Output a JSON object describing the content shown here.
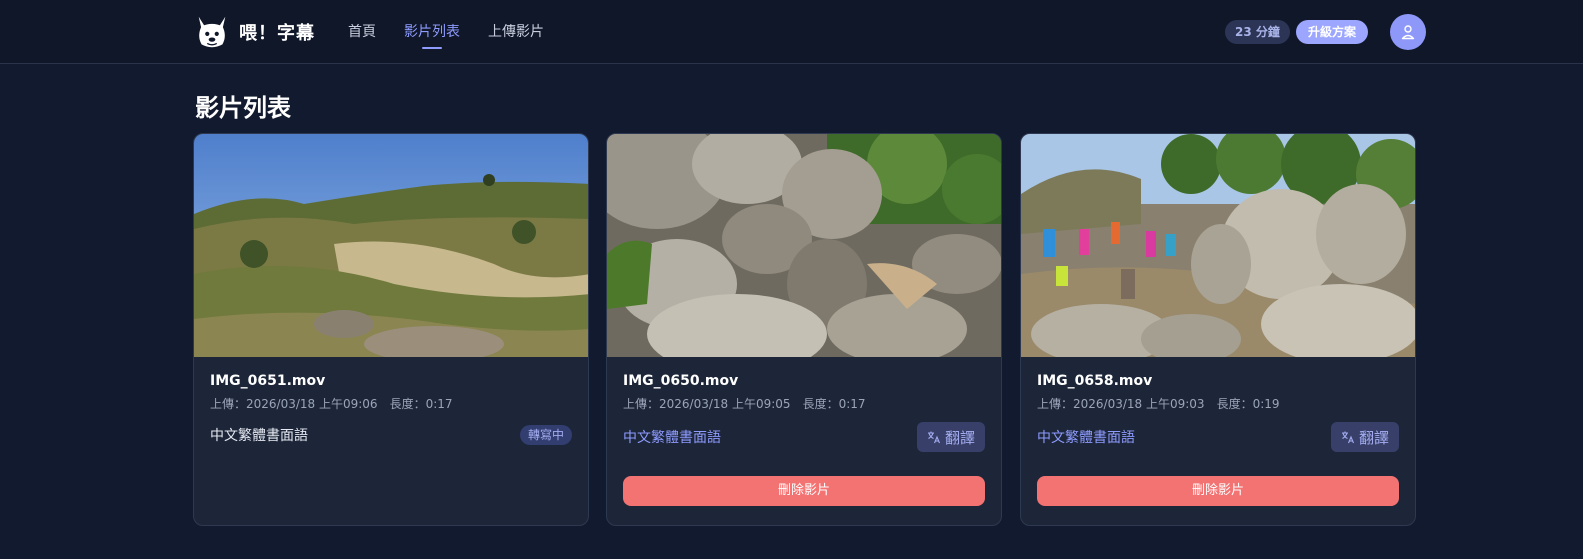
{
  "brand": {
    "name": "喂！字幕",
    "logo_icon": "french-bulldog-logo-icon"
  },
  "nav": [
    {
      "label": "首頁",
      "active": false
    },
    {
      "label": "影片列表",
      "active": true
    },
    {
      "label": "上傳影片",
      "active": false
    }
  ],
  "account": {
    "minutes_left": "23 分鐘",
    "upgrade_label": "升級方案",
    "avatar_icon": "user-icon"
  },
  "page": {
    "title": "影片列表"
  },
  "videos": [
    {
      "file_name": "IMG_0651.mov",
      "uploaded": "上傳：2026/03/18 上午09:06",
      "duration": "長度：0:17",
      "language": "中文繁體書面語",
      "status": "轉寫中",
      "thumbnail": "hillside-grass-thumbnail"
    },
    {
      "file_name": "IMG_0650.mov",
      "uploaded": "上傳：2026/03/18 上午09:05",
      "duration": "長度：0:17",
      "language": "中文繁體書面語",
      "translate_label": "翻譯",
      "delete_label": "刪除影片",
      "thumbnail": "boulders-thumbnail"
    },
    {
      "file_name": "IMG_0658.mov",
      "uploaded": "上傳：2026/03/18 上午09:03",
      "duration": "長度：0:19",
      "language": "中文繁體書面語",
      "translate_label": "翻譯",
      "delete_label": "刪除影片",
      "thumbnail": "hikers-rocks-thumbnail"
    }
  ],
  "colors": {
    "background": "#111a2e",
    "header": "#0f1729",
    "card": "#1c2638",
    "accent": "#8e9bff",
    "danger": "#f37272"
  }
}
